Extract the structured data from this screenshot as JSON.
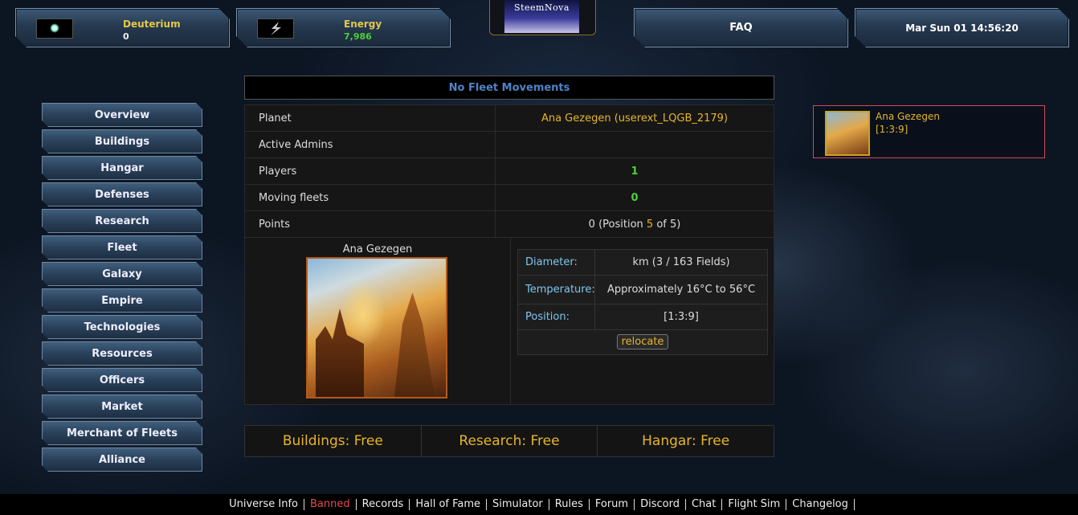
{
  "resources": {
    "deuterium": {
      "name": "Deuterium",
      "value": "0",
      "icon": "deuterium-icon"
    },
    "energy": {
      "name": "Energy",
      "value": "7,986",
      "value_color": "#4cd137",
      "icon": "energy-icon"
    }
  },
  "logo": {
    "text": "SteemNova"
  },
  "header": {
    "faq": "FAQ",
    "datetime": "Mar Sun 01 14:56:20"
  },
  "menu": [
    "Overview",
    "Buildings",
    "Hangar",
    "Defenses",
    "Research",
    "Fleet",
    "Galaxy",
    "Empire",
    "Technologies",
    "Resources",
    "Officers",
    "Market",
    "Merchant of Fleets",
    "Alliance"
  ],
  "fleet": {
    "status": "No Fleet Movements"
  },
  "overview": {
    "planet_label": "Planet",
    "planet_value": "Ana Gezegen (userext_LQGB_2179)",
    "admins_label": "Active Admins",
    "admins_value": "",
    "players_label": "Players",
    "players_value": "1",
    "moving_label": "Moving fleets",
    "moving_value": "0",
    "points_label": "Points",
    "points_prefix": "0 (Position ",
    "points_rank": "5",
    "points_suffix": " of 5)"
  },
  "planet": {
    "name": "Ana Gezegen",
    "diameter_label": "Diameter:",
    "diameter_value": "km (3 / 163 Fields)",
    "temperature_label": "Temperature:",
    "temperature_value": "Approximately 16°C to 56°C",
    "position_label": "Position:",
    "position_value": "[1:3:9]",
    "relocate": "relocate"
  },
  "queue": {
    "buildings": "Buildings: Free",
    "research": "Research: Free",
    "hangar": "Hangar: Free"
  },
  "planet_list": [
    {
      "name": "Ana Gezegen",
      "coords": "[1:3:9]"
    }
  ],
  "footer": [
    {
      "label": "Universe Info"
    },
    {
      "label": "Banned",
      "color": "#e04b4b"
    },
    {
      "label": "Records"
    },
    {
      "label": "Hall of Fame"
    },
    {
      "label": "Simulator"
    },
    {
      "label": "Rules"
    },
    {
      "label": "Forum"
    },
    {
      "label": "Discord"
    },
    {
      "label": "Chat"
    },
    {
      "label": "Flight Sim"
    },
    {
      "label": "Changelog"
    }
  ]
}
